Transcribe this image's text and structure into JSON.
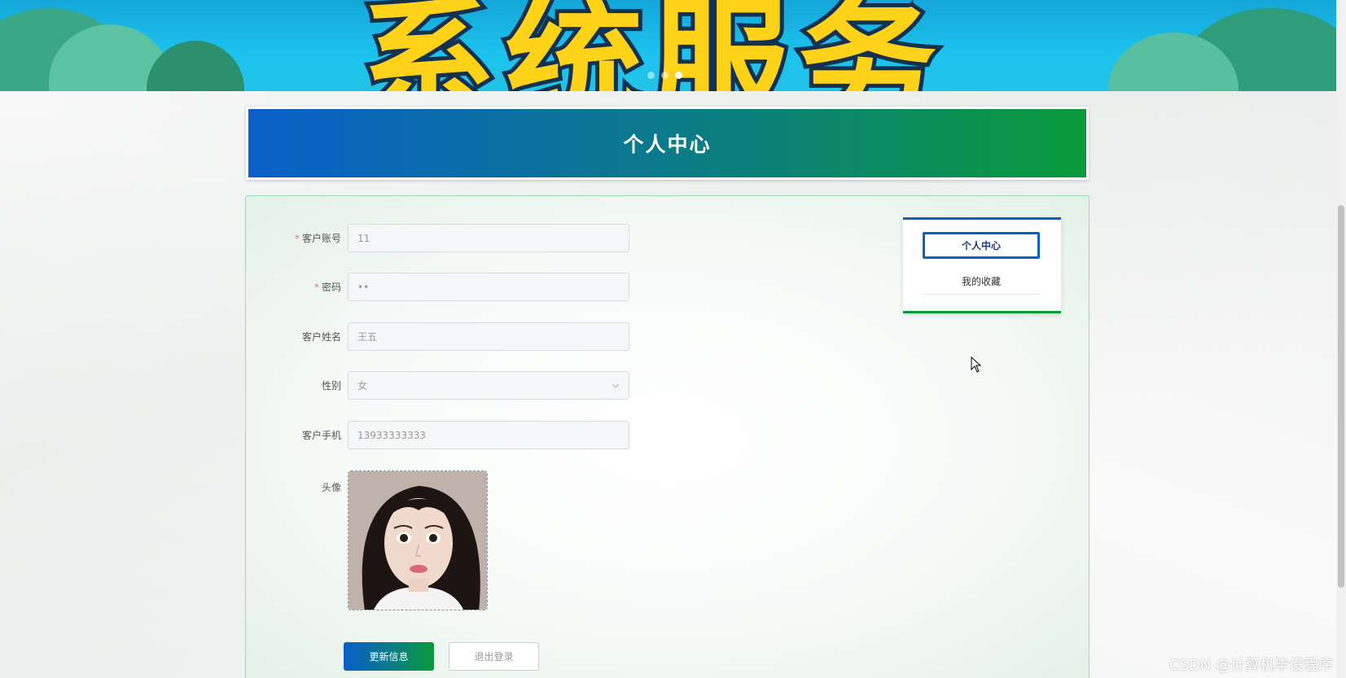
{
  "banner": {
    "text": "系统服务",
    "dots": 3,
    "active_dot": 3
  },
  "header": {
    "title": "个人中心"
  },
  "form": {
    "fields": [
      {
        "label": "客户账号",
        "required": true,
        "value": "11"
      },
      {
        "label": "密码",
        "required": true,
        "value": "••"
      },
      {
        "label": "客户姓名",
        "required": false,
        "value": "王五"
      },
      {
        "label": "性别",
        "required": false,
        "value": "女",
        "type": "select"
      },
      {
        "label": "客户手机",
        "required": false,
        "value": "13933333333"
      }
    ],
    "avatar_label": "头像",
    "required_mark": "*"
  },
  "buttons": {
    "update_label": "更新信息",
    "logout_label": "退出登录"
  },
  "side_menu": {
    "items": [
      {
        "label": "个人中心",
        "active": true
      },
      {
        "label": "我的收藏",
        "active": false
      }
    ]
  },
  "watermark": "CSDN @计算机毕设程序",
  "colors": {
    "gradient_start": "#0a5fc8",
    "gradient_end": "#0a9a3a",
    "required": "#f56c6c"
  }
}
